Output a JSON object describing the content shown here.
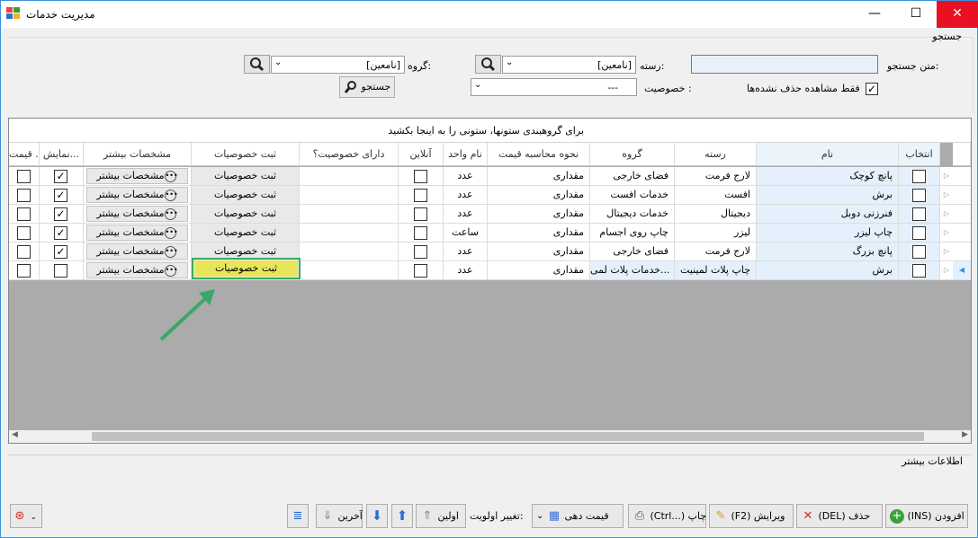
{
  "window": {
    "title": "مدیریت خدمات",
    "min_glyph": "—",
    "max_glyph": "☐",
    "close_glyph": "✕"
  },
  "search": {
    "legend": "جستجو",
    "text_label": "متن جستجو:",
    "text_value": "",
    "category_label": "رسته:",
    "category_value": "[نامعین]",
    "group_label": "گروه:",
    "group_value": "[نامعین]",
    "property_label": "خصوصیت :",
    "property_value": "---",
    "deleted_only_label": "فقط مشاهده حذف نشده‌ها",
    "deleted_only_checked": "✓",
    "search_button": "جستجو"
  },
  "grid": {
    "group_hint": "برای گروهبندی ستونها، ستونی را به اینجا بکشید",
    "columns": {
      "select": "انتخاب",
      "name": "نام",
      "category": "رسته",
      "group": "گروه",
      "calc": "نحوه محاسبه قیمت",
      "unit": "نام واحد",
      "online": "آنلاین",
      "has_prop": "دارای خصوصیت؟",
      "reg_prop": "ثبت خصوصیات",
      "more": "مشخصات بیشتر",
      "show": "نمایش...",
      "price": "قیمت ..."
    },
    "rows": [
      {
        "name": "پانچ کوچک",
        "category": "لارج فرمت",
        "group": "فضای خارجی",
        "calc": "مقداری",
        "unit": "عدد",
        "reg": "ثبت خصوصیات",
        "more": "مشخصات بیشتر",
        "show": "✓"
      },
      {
        "name": "برش",
        "category": "افست",
        "group": "خدمات افست",
        "calc": "مقداری",
        "unit": "عدد",
        "reg": "ثبت خصوصیات",
        "more": "مشخصات بیشتر",
        "show": "✓"
      },
      {
        "name": "فنرزنی دوبل",
        "category": "دیجیتال",
        "group": "خدمات دیجیتال",
        "calc": "مقداری",
        "unit": "عدد",
        "reg": "ثبت خصوصیات",
        "more": "مشخصات بیشتر",
        "show": "✓"
      },
      {
        "name": "چاپ لیزر",
        "category": "لیزر",
        "group": "چاپ روی اجسام",
        "calc": "مقداری",
        "unit": "ساعت",
        "reg": "ثبت خصوصیات",
        "more": "مشخصات بیشتر",
        "show": "✓"
      },
      {
        "name": "پانچ بزرگ",
        "category": "لارج فرمت",
        "group": "فضای خارجی",
        "calc": "مقداری",
        "unit": "عدد",
        "reg": "ثبت خصوصیات",
        "more": "مشخصات بیشتر",
        "show": "✓"
      },
      {
        "name": "برش",
        "category": "چاپ پلات لمینیت",
        "group": "خدمات پلات لمی...",
        "calc": "مقداری",
        "unit": "عدد",
        "reg": "ثبت خصوصیات",
        "more": "مشخصات بیشتر",
        "show": ""
      }
    ]
  },
  "more_info": {
    "label": "اطلاعات بیشتر"
  },
  "toolbar": {
    "add": "(INS) افزودن",
    "delete": "(DEL) حذف",
    "edit": "(F2) ویرایش",
    "print": "(Ctrl...) چاپ",
    "pricing": "قیمت دهی",
    "priority_label": "تغییر اولویت:",
    "first": "اولین",
    "last": "آخرین"
  },
  "colors": {
    "accent": "#3c8fd6",
    "highlight": "#e8e55a",
    "callout": "#3aa86b",
    "close": "#e81123"
  }
}
